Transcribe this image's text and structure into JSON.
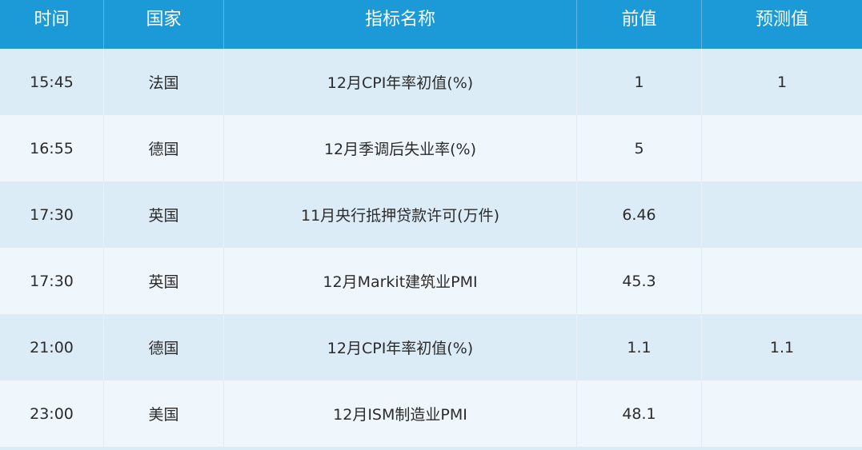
{
  "header": {
    "time": "时间",
    "country": "国家",
    "indicator": "指标名称",
    "previous": "前值",
    "forecast": "预测值"
  },
  "rows": [
    {
      "time": "15:45",
      "country": "法国",
      "indicator": "12月CPI年率初值(%)",
      "previous": "1",
      "forecast": "1"
    },
    {
      "time": "16:55",
      "country": "德国",
      "indicator": "12月季调后失业率(%)",
      "previous": "5",
      "forecast": ""
    },
    {
      "time": "17:30",
      "country": "英国",
      "indicator": "11月央行抵押贷款许可(万件)",
      "previous": "6.46",
      "forecast": ""
    },
    {
      "time": "17:30",
      "country": "英国",
      "indicator": "12月Markit建筑业PMI",
      "previous": "45.3",
      "forecast": ""
    },
    {
      "time": "21:00",
      "country": "德国",
      "indicator": "12月CPI年率初值(%)",
      "previous": "1.1",
      "forecast": "1.1"
    },
    {
      "time": "23:00",
      "country": "美国",
      "indicator": "12月ISM制造业PMI",
      "previous": "48.1",
      "forecast": ""
    }
  ],
  "colors": {
    "header_bg": "#1c9ad7",
    "row_odd_bg": "#dbecf7",
    "row_even_bg": "#eff7fd"
  }
}
